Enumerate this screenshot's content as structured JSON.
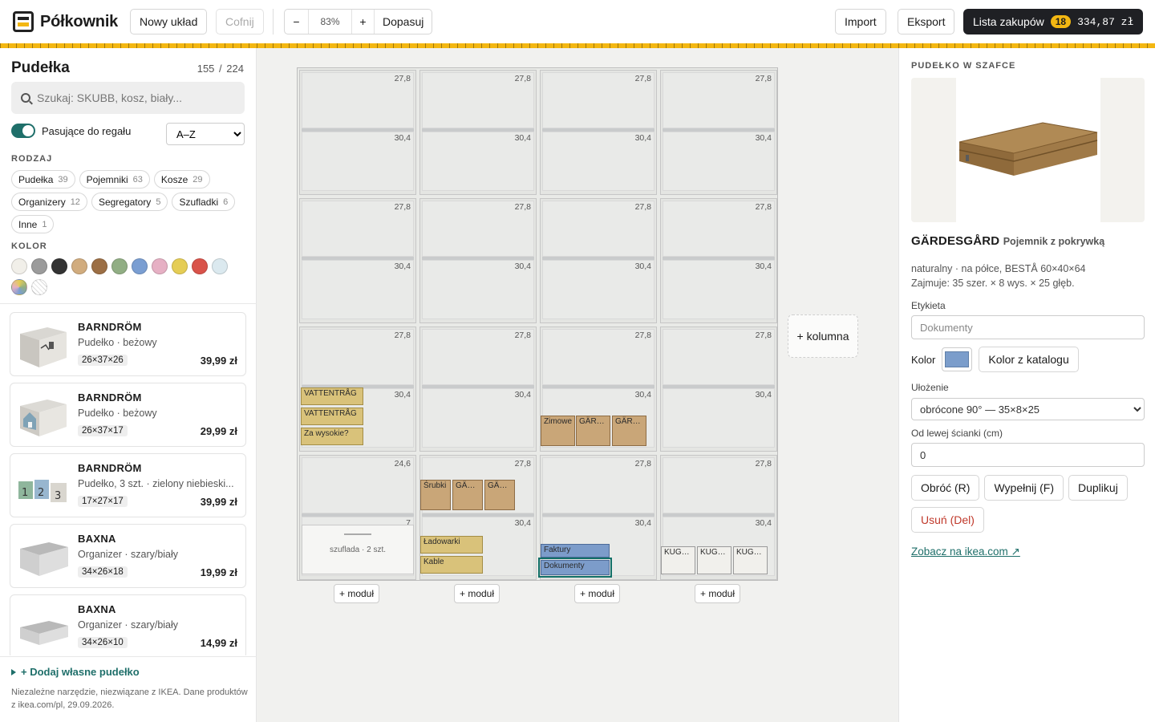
{
  "app": {
    "name": "Półkownik"
  },
  "toolbar": {
    "new_layout": "Nowy układ",
    "undo": "Cofnij",
    "zoom_out": "−",
    "zoom_value": "83%",
    "zoom_in": "+",
    "fit": "Dopasuj",
    "import": "Import",
    "export": "Eksport",
    "shopping_list": "Lista zakupów",
    "shopping_count": "18",
    "shopping_total": "334,87 zł"
  },
  "sidebar": {
    "title": "Pudełka",
    "count_shown": "155",
    "count_sep": "/",
    "count_total": "224",
    "search_placeholder": "Szukaj: SKUBB, kosz, biały...",
    "fit_toggle_label": "Pasujące do regału",
    "fit_toggle_on": true,
    "sort_value": "A–Z",
    "type_heading": "RODZAJ",
    "types": [
      {
        "label": "Pudełka",
        "count": "39"
      },
      {
        "label": "Pojemniki",
        "count": "63"
      },
      {
        "label": "Kosze",
        "count": "29"
      },
      {
        "label": "Organizery",
        "count": "12"
      },
      {
        "label": "Segregatory",
        "count": "5"
      },
      {
        "label": "Szufladki",
        "count": "6"
      },
      {
        "label": "Inne",
        "count": "1"
      }
    ],
    "color_heading": "KOLOR",
    "colors": [
      "#f1efe9",
      "#9b9b9b",
      "#333333",
      "#d1ac7e",
      "#9c6f45",
      "#91ae84",
      "#7a9ed2",
      "#e6b0c4",
      "#e5cd55",
      "#d9534a",
      "#dbe9ef",
      "multicolor",
      "none"
    ],
    "products": [
      {
        "name": "BARNDRÖM",
        "subtitle": "Pudełko · beżowy",
        "dims": "26×37×26",
        "price": "39,99 zł",
        "icon": "fabric-box-cat-icon"
      },
      {
        "name": "BARNDRÖM",
        "subtitle": "Pudełko · beżowy",
        "dims": "26×37×17",
        "price": "29,99 zł",
        "icon": "fabric-box-house-icon"
      },
      {
        "name": "BARNDRÖM",
        "subtitle": "Pudełko, 3 szt. · zielony niebieski...",
        "dims": "17×27×17",
        "price": "39,99 zł",
        "icon": "numbered-boxes-icon"
      },
      {
        "name": "BAXNA",
        "subtitle": "Organizer · szary/biały",
        "dims": "34×26×18",
        "price": "19,99 zł",
        "icon": "grey-organizer-icon"
      },
      {
        "name": "BAXNA",
        "subtitle": "Organizer · szary/biały",
        "dims": "34×26×10",
        "price": "14,99 zł",
        "icon": "grey-organizer-low-icon"
      }
    ],
    "add_own": "+ Dodaj własne pudełko",
    "disclaimer": "Niezależne narzędzie, niezwiązane z IKEA. Dane produktów z ikea.com/pl, 29.09.2026."
  },
  "canvas": {
    "add_column": "+ kolumna",
    "add_module": "+ moduł",
    "compartment_heights": [
      "27,8",
      "30,4",
      "24,6",
      "7"
    ],
    "drawer_label": "szuflada · 2 szt.",
    "boxes": [
      {
        "label": "VATTENTRÅG",
        "color": "yellow"
      },
      {
        "label": "VATTENTRÅG",
        "color": "yellow"
      },
      {
        "label": "Za wysokie?",
        "color": "yellow"
      },
      {
        "label": "Zimowe",
        "color": "tan"
      },
      {
        "label": "GÄRDESGÅRD",
        "color": "tan"
      },
      {
        "label": "GÄRDESGÅRD",
        "color": "tan"
      },
      {
        "label": "Śrubki",
        "color": "tan"
      },
      {
        "label": "GÄRDESGÅRD",
        "color": "tan"
      },
      {
        "label": "GÄRDESGÅRD",
        "color": "tan"
      },
      {
        "label": "Ładowarki",
        "color": "yellow"
      },
      {
        "label": "Kable",
        "color": "yellow"
      },
      {
        "label": "Faktury",
        "color": "blue"
      },
      {
        "label": "Dokumenty",
        "color": "blue",
        "selected": true
      },
      {
        "label": "KUGGIS",
        "color": "white"
      },
      {
        "label": "KUGGIS",
        "color": "white"
      },
      {
        "label": "KUGGIS",
        "color": "white"
      }
    ]
  },
  "panel": {
    "section": "PUDEŁKO W SZAFCE",
    "name": "GÄRDESGÅRD",
    "type": "Pojemnik z pokrywką",
    "meta1": "naturalny · na półce, BESTÅ 60×40×64",
    "meta2": "Zajmuje: 35 szer. × 8 wys. × 25 głęb.",
    "label_field": "Etykieta",
    "label_placeholder": "Dokumenty",
    "color_label": "Kolor",
    "color_value": "#7b9dcb",
    "catalog_color": "Kolor z katalogu",
    "orientation_label": "Ułożenie",
    "orientation_value": "obrócone 90° — 35×8×25",
    "offset_label": "Od lewej ścianki (cm)",
    "offset_value": "0",
    "rotate": "Obróć (R)",
    "fill": "Wypełnij (F)",
    "duplicate": "Duplikuj",
    "delete": "Usuń (Del)",
    "ikea_link": "Zobacz na ikea.com ↗"
  }
}
